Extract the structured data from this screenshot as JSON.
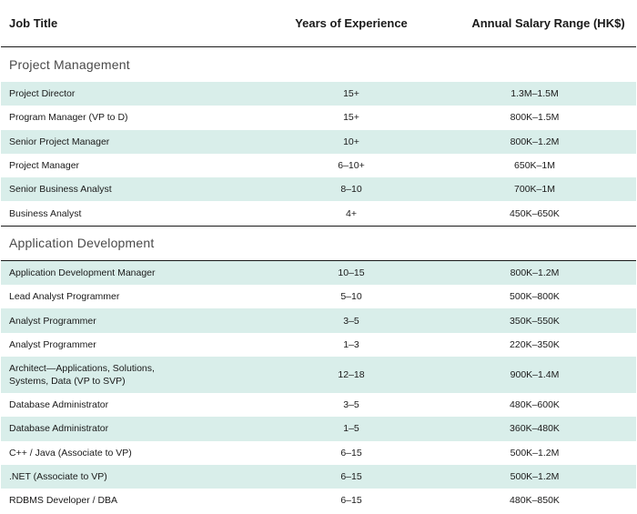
{
  "header": {
    "job_title": "Job Title",
    "years": "Years of Experience",
    "salary": "Annual Salary Range (HK$)"
  },
  "sections": [
    {
      "title": "Project Management",
      "rows": [
        {
          "title": "Project Director",
          "years": "15+",
          "salary": "1.3M–1.5M"
        },
        {
          "title": "Program Manager (VP to D)",
          "years": "15+",
          "salary": "800K–1.5M"
        },
        {
          "title": "Senior Project Manager",
          "years": "10+",
          "salary": "800K–1.2M"
        },
        {
          "title": "Project Manager",
          "years": "6–10+",
          "salary": "650K–1M"
        },
        {
          "title": "Senior Business Analyst",
          "years": "8–10",
          "salary": "700K–1M"
        },
        {
          "title": "Business Analyst",
          "years": "4+",
          "salary": "450K–650K"
        }
      ]
    },
    {
      "title": "Application Development",
      "rows": [
        {
          "title": "Application Development Manager",
          "years": "10–15",
          "salary": "800K–1.2M"
        },
        {
          "title": "Lead Analyst Programmer",
          "years": "5–10",
          "salary": "500K–800K"
        },
        {
          "title": "Analyst Programmer",
          "years": "3–5",
          "salary": "350K–550K"
        },
        {
          "title": "Analyst Programmer",
          "years": "1–3",
          "salary": "220K–350K"
        },
        {
          "title": "Architect—Applications, Solutions,",
          "title2": "Systems, Data (VP to SVP)",
          "years": "12–18",
          "salary": "900K–1.4M"
        },
        {
          "title": "Database Administrator",
          "years": "3–5",
          "salary": "480K–600K"
        },
        {
          "title": "Database Administrator",
          "years": "1–5",
          "salary": "360K–480K"
        },
        {
          "title": "C++ / Java (Associate to VP)",
          "years": "6–15",
          "salary": "500K–1.2M"
        },
        {
          "title": ".NET  (Associate to VP)",
          "years": "6–15",
          "salary": "500K–1.2M"
        },
        {
          "title": "RDBMS Developer / DBA",
          "years": "6–15",
          "salary": "480K–850K"
        }
      ]
    }
  ],
  "colors": {
    "row_shade": "#d9eeea",
    "rule": "#1a1a1a"
  }
}
